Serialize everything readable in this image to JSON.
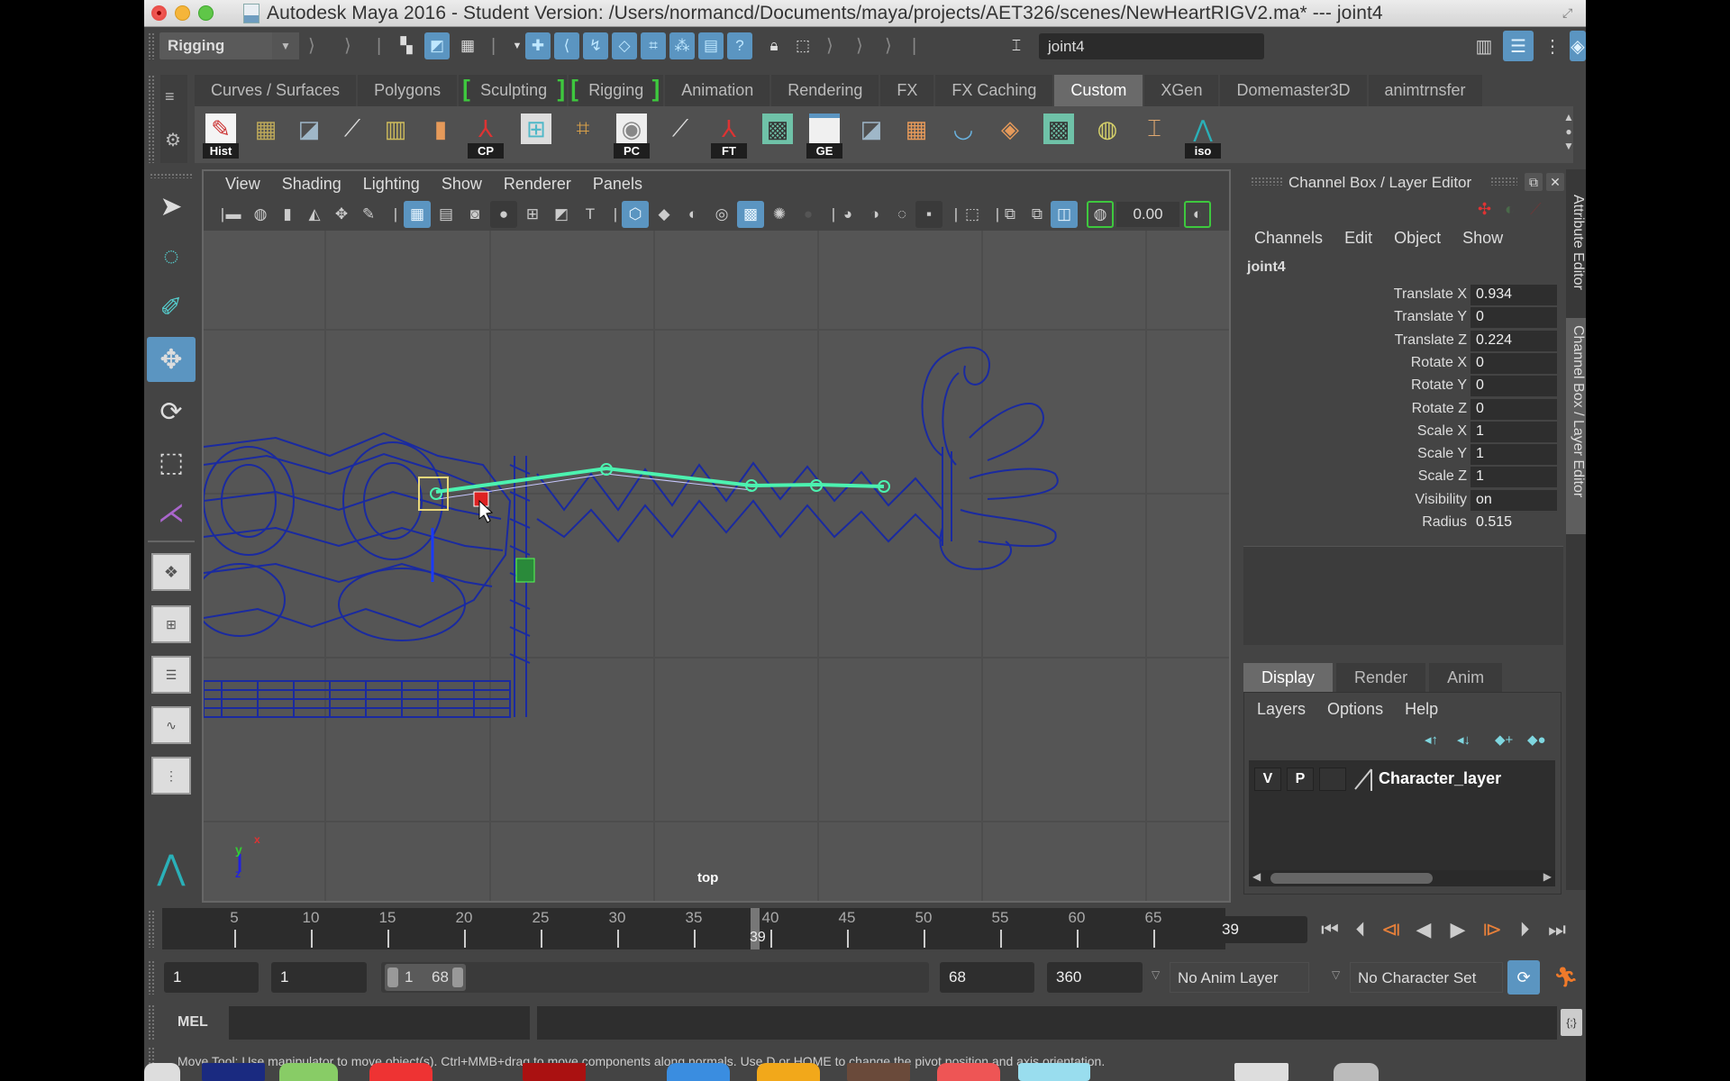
{
  "window": {
    "title": "Autodesk Maya 2016 - Student Version: /Users/normancd/Documents/maya/projects/AET326/scenes/NewHeartRIGV2.ma*   ---   joint4"
  },
  "status_line": {
    "menu_set": "Rigging",
    "selected_object_field": "joint4",
    "icons": [
      "select-by-hierarchy-icon",
      "select-by-object-type-icon",
      "select-by-component-type-icon",
      "snap-to-grid-icon",
      "snap-to-curve-icon",
      "snap-to-point-icon",
      "snap-to-view-plane-icon",
      "make-live-icon",
      "history-icon",
      "render-view-icon",
      "question-icon",
      "lock-icon",
      "selection-highlight-icon",
      "input-line-icon"
    ],
    "right_icons": [
      "modeling-toolkit-icon",
      "attribute-editor-toggle-icon",
      "tool-settings-toggle-icon",
      "channel-box-toggle-icon"
    ]
  },
  "shelf": {
    "tabs": [
      {
        "label": "Curves / Surfaces",
        "active": false
      },
      {
        "label": "Polygons",
        "active": false
      },
      {
        "label": "Sculpting",
        "active": false,
        "bracketed": true
      },
      {
        "label": "Rigging",
        "active": false,
        "bracketed": true
      },
      {
        "label": "Animation",
        "active": false
      },
      {
        "label": "Rendering",
        "active": false
      },
      {
        "label": "FX",
        "active": false
      },
      {
        "label": "FX Caching",
        "active": false
      },
      {
        "label": "Custom",
        "active": true
      },
      {
        "label": "XGen",
        "active": false
      },
      {
        "label": "Domemaster3D",
        "active": false
      },
      {
        "label": "animtrnsfer",
        "active": false
      }
    ],
    "buttons": [
      {
        "icon": "delete-history-icon",
        "label": "Hist"
      },
      {
        "icon": "smooth-skin-icon",
        "label": ""
      },
      {
        "icon": "paint-weights-icon",
        "label": ""
      },
      {
        "icon": "joint-tool-icon",
        "label": ""
      },
      {
        "icon": "lattice-icon",
        "label": ""
      },
      {
        "icon": "extrude-icon",
        "label": ""
      },
      {
        "icon": "center-pivot-icon",
        "label": "CP"
      },
      {
        "icon": "hypergraph-icon",
        "label": ""
      },
      {
        "icon": "delete-deformer-icon",
        "label": ""
      },
      {
        "icon": "paint-canvas-icon",
        "label": "PC"
      },
      {
        "icon": "ik-handle-icon",
        "label": ""
      },
      {
        "icon": "freeze-transforms-icon",
        "label": "FT"
      },
      {
        "icon": "uv-editor-icon",
        "label": ""
      },
      {
        "icon": "graph-editor-icon",
        "label": "GE"
      },
      {
        "icon": "bind-skin-icon",
        "label": ""
      },
      {
        "icon": "uv-layout-icon",
        "label": ""
      },
      {
        "icon": "paint-skin-weights-icon",
        "label": ""
      },
      {
        "icon": "hypershade-icon",
        "label": ""
      },
      {
        "icon": "checker-icon",
        "label": ""
      },
      {
        "icon": "paint-effects-icon",
        "label": ""
      },
      {
        "icon": "cluster-icon",
        "label": ""
      },
      {
        "icon": "isolate-select-icon",
        "label": "iso"
      }
    ]
  },
  "toolbox": {
    "tools": [
      {
        "name": "select-tool",
        "active": false
      },
      {
        "name": "lasso-tool",
        "active": false
      },
      {
        "name": "paint-select-tool",
        "active": false
      },
      {
        "name": "move-tool",
        "active": true
      },
      {
        "name": "rotate-tool",
        "active": false
      },
      {
        "name": "scale-tool",
        "active": false
      },
      {
        "name": "last-tool",
        "active": false
      }
    ]
  },
  "viewport": {
    "menus": [
      "View",
      "Shading",
      "Lighting",
      "Show",
      "Renderer",
      "Panels"
    ],
    "exposure_value": "0.00",
    "camera_label": "top",
    "axis": {
      "y": "y",
      "x": "x",
      "z": "z"
    }
  },
  "channel_box": {
    "title": "Channel Box / Layer Editor",
    "menus": [
      "Channels",
      "Edit",
      "Object",
      "Show"
    ],
    "object_name": "joint4",
    "attributes": [
      {
        "name": "Translate X",
        "value": "0.934"
      },
      {
        "name": "Translate Y",
        "value": "0"
      },
      {
        "name": "Translate Z",
        "value": "0.224"
      },
      {
        "name": "Rotate X",
        "value": "0"
      },
      {
        "name": "Rotate Y",
        "value": "0"
      },
      {
        "name": "Rotate Z",
        "value": "0"
      },
      {
        "name": "Scale X",
        "value": "1"
      },
      {
        "name": "Scale Y",
        "value": "1"
      },
      {
        "name": "Scale Z",
        "value": "1"
      },
      {
        "name": "Visibility",
        "value": "on"
      },
      {
        "name": "Radius",
        "value": "0.515"
      }
    ]
  },
  "side_tabs": [
    "Attribute Editor",
    "Channel Box / Layer Editor"
  ],
  "layer_editor": {
    "tabs": [
      {
        "label": "Display",
        "active": true
      },
      {
        "label": "Render",
        "active": false
      },
      {
        "label": "Anim",
        "active": false
      }
    ],
    "menus": [
      "Layers",
      "Options",
      "Help"
    ],
    "layers": [
      {
        "visible": "V",
        "playback": "P",
        "name": "Character_layer"
      }
    ]
  },
  "time_slider": {
    "tick_labels": [
      "5",
      "10",
      "15",
      "20",
      "25",
      "30",
      "35",
      "40",
      "45",
      "50",
      "55",
      "60",
      "65"
    ],
    "current_frame": "39",
    "current_frame_field": "39",
    "range_min": 1,
    "range_max": 68
  },
  "range_slider": {
    "start_time": "1",
    "playback_start": "1",
    "range_start_label": "1",
    "range_end_label": "68",
    "playback_end": "68",
    "end_time": "360",
    "anim_layer": "No Anim Layer",
    "character_set": "No Character Set"
  },
  "playback": {
    "buttons": [
      "go-to-start-icon",
      "step-back-frame-icon",
      "step-back-key-icon",
      "play-backwards-icon",
      "play-forwards-icon",
      "step-forward-key-icon",
      "step-forward-frame-icon",
      "go-to-end-icon"
    ]
  },
  "command_line": {
    "label": "MEL",
    "input": "",
    "output": ""
  },
  "help_line": "Move Tool: Use manipulator to move object(s). Ctrl+MMB+drag to move components along normals. Use D or HOME to change the pivot position and axis orientation."
}
